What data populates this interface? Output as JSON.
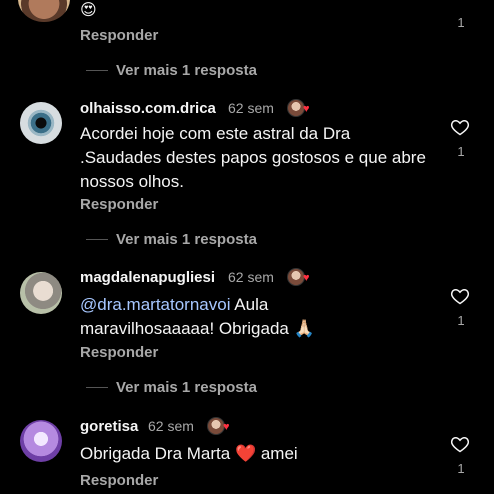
{
  "top": {
    "emoji": "😍",
    "reply_label": "Responder",
    "like_count": "1",
    "more_replies": "Ver mais 1 resposta"
  },
  "comments": [
    {
      "username": "olhaisso.com.drica",
      "time": "62 sem",
      "text": "Acordei hoje com este astral da Dra .Saudades destes papos gostosos e que abre nossos olhos.",
      "reply_label": "Responder",
      "like_count": "1",
      "more_replies": "Ver mais 1 resposta"
    },
    {
      "username": "magdalenapugliesi",
      "time": "62 sem",
      "mention": "@dra.martatornavoi",
      "text": " Aula maravilhosaaaaa! Obrigada 🙏🏻",
      "reply_label": "Responder",
      "like_count": "1",
      "more_replies": "Ver mais 1 resposta"
    },
    {
      "username": "goretisa",
      "time": "62 sem",
      "text": "Obrigada Dra Marta ❤️ amei",
      "reply_label": "Responder",
      "like_count": "1"
    }
  ],
  "colors": {
    "background": "#000000",
    "text": "#f5f5f5",
    "secondary": "#a8a8a8",
    "mention": "#a7c7ff",
    "heart": "#ff3040"
  },
  "icons": [
    "heart-outline-icon",
    "author-liked-heart-icon"
  ]
}
